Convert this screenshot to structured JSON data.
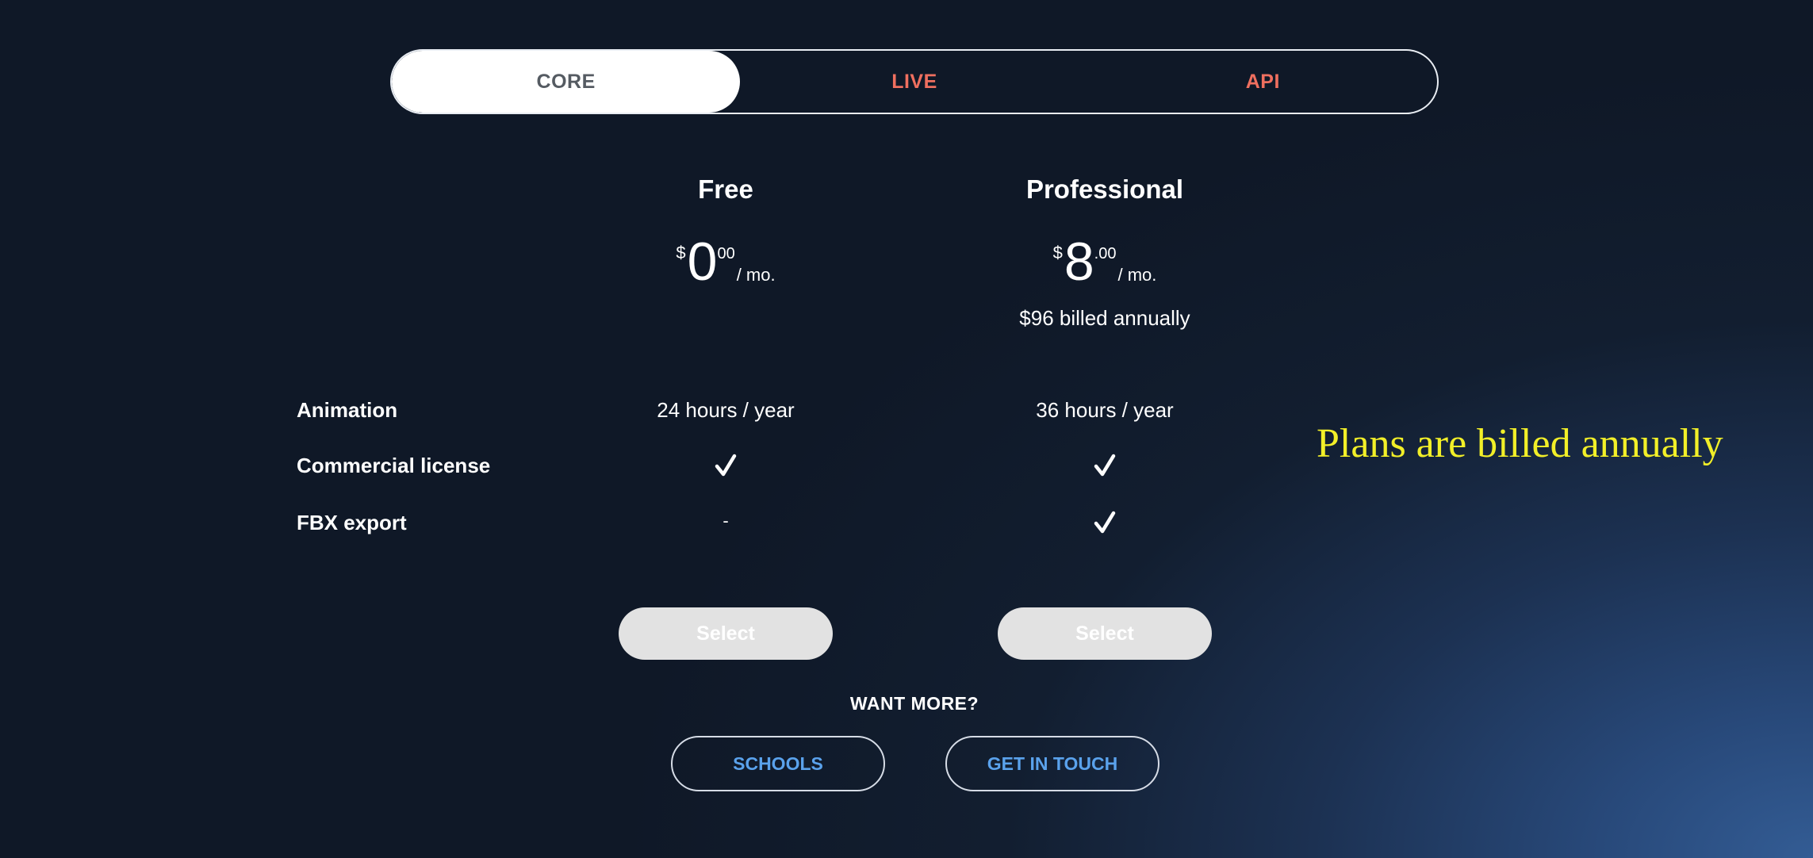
{
  "tabs": [
    {
      "label": "CORE",
      "active": true
    },
    {
      "label": "LIVE",
      "active": false
    },
    {
      "label": "API",
      "active": false
    }
  ],
  "plans": [
    {
      "name": "Free",
      "currency": "$",
      "amount": "0",
      "cents": "00",
      "period": "/ mo.",
      "billed": "",
      "select_label": "Select"
    },
    {
      "name": "Professional",
      "currency": "$",
      "amount": "8",
      "cents": ".00",
      "period": "/ mo.",
      "billed": "$96 billed annually",
      "select_label": "Select"
    }
  ],
  "features": [
    {
      "label": "Animation",
      "free": "24 hours / year",
      "pro": "36 hours / year"
    },
    {
      "label": "Commercial license",
      "free": "check",
      "pro": "check"
    },
    {
      "label": "FBX export",
      "free": "-",
      "pro": "check"
    }
  ],
  "want_more": {
    "heading": "WANT MORE?",
    "schools_label": "SCHOOLS",
    "contact_label": "GET IN TOUCH"
  },
  "overlay_note": "Plans are billed annually",
  "colors": {
    "accent_tab": "#ef6f5f",
    "link_blue": "#5aa2ec",
    "note_yellow": "#f2ef28",
    "select_bg": "#e2e2e2"
  },
  "icons": {
    "check": "check-icon"
  }
}
